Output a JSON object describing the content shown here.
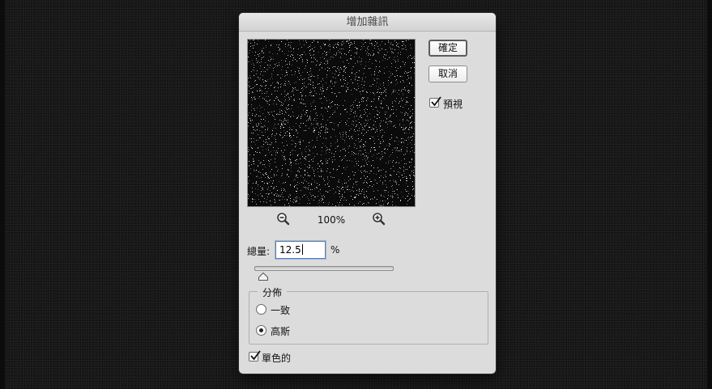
{
  "dialog": {
    "title": "增加雜訊"
  },
  "buttons": {
    "ok_label": "確定",
    "cancel_label": "取消"
  },
  "preview_option": {
    "label": "預視",
    "checked": true
  },
  "zoom": {
    "level": "100%",
    "out_icon": "zoom-out-icon",
    "in_icon": "zoom-in-icon"
  },
  "amount": {
    "label": "總量:",
    "value": "12.5",
    "unit": "%",
    "slider_fraction": 0.03
  },
  "distribution": {
    "label": "分佈",
    "options": [
      {
        "label": "一致",
        "selected": false
      },
      {
        "label": "高斯",
        "selected": true
      }
    ]
  },
  "monochromatic": {
    "label": "單色的",
    "checked": true
  },
  "colors": {
    "dialog_bg": "#dcdcdc",
    "canvas_bg": "#171717",
    "preview_bg": "#0b0b0b"
  }
}
